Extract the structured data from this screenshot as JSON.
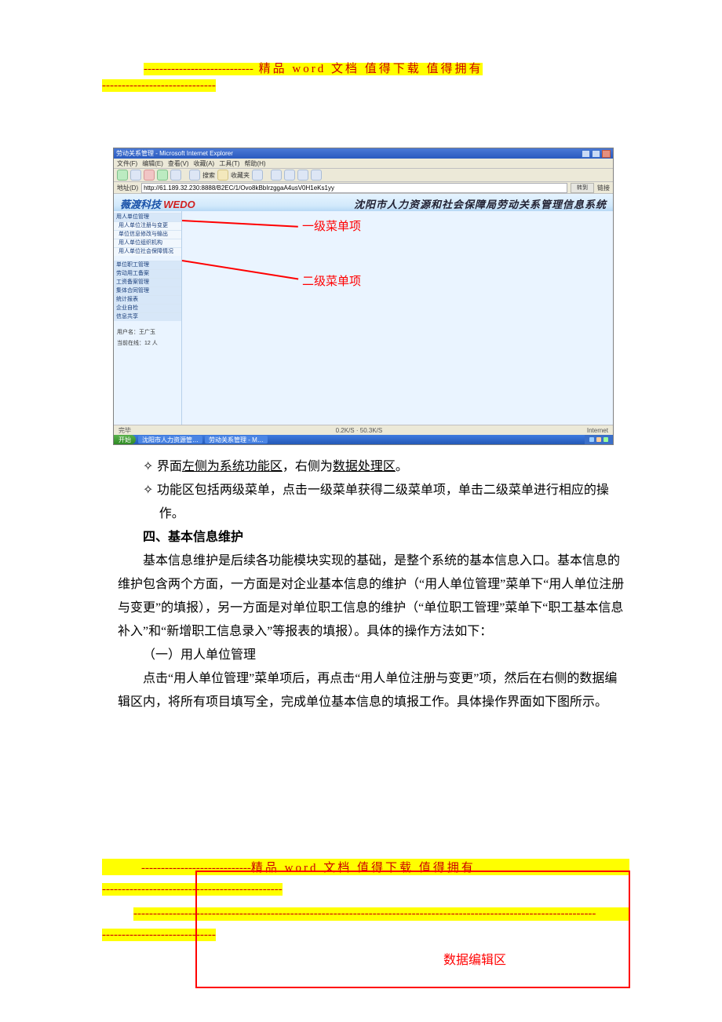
{
  "header": {
    "dashes1": "----------------------------",
    "line1_text": " 精品 word 文档  值得下载  值得拥有",
    "dashes2": "----------------------------------------------------------------------------------------------------------------------",
    "dashes2_second": "-----------------------------"
  },
  "screenshot": {
    "title": "劳动关系管理 - Microsoft Internet Explorer",
    "menus": [
      "文件(F)",
      "编辑(E)",
      "查看(V)",
      "收藏(A)",
      "工具(T)",
      "帮助(H)"
    ],
    "search_label": "搜索",
    "fav_label": "收藏夹",
    "addr_label": "地址(D)",
    "url": "http://61.189.32.230:8888/B2EC/1/Ovo8kBbIrzggaA4usV0H1eKs1yy",
    "go_label": "转到",
    "links_label": "链接",
    "logo_cn": "薇渡科技",
    "logo_en": "WEDO",
    "system_title": "沈阳市人力资源和社会保障局劳动关系管理信息系统",
    "side_menu": [
      {
        "label": "用人单位管理",
        "type": "top"
      },
      {
        "label": "用人单位注册与变更",
        "type": "sub"
      },
      {
        "label": "单位信息修改与输出",
        "type": "sub"
      },
      {
        "label": "用人单位组织机构",
        "type": "sub"
      },
      {
        "label": "用人单位社会保障情况",
        "type": "sub"
      },
      {
        "label": "单位职工管理",
        "type": "top"
      },
      {
        "label": "劳动用工备案",
        "type": "top"
      },
      {
        "label": "工资备案管理",
        "type": "top"
      },
      {
        "label": "集体合同管理",
        "type": "top"
      },
      {
        "label": "统计报表",
        "type": "top"
      },
      {
        "label": "企业自检",
        "type": "top"
      },
      {
        "label": "信息共享",
        "type": "top"
      }
    ],
    "user_label": "用户名：王广玉",
    "online_label": "当前在线：12 人",
    "status_left": "完毕",
    "status_mid": "0.2K/S · 50.3K/S",
    "status_right": "Internet",
    "start": "开始",
    "task_items": [
      "沈阳市人力资源管…",
      "劳动关系管理 - M…"
    ],
    "annotations": {
      "level1": "一级菜单项",
      "level2": "二级菜单项"
    }
  },
  "body": {
    "bullets": [
      "界面左侧为系统功能区，右侧为数据处理区。",
      "功能区包括两级菜单，点击一级菜单获得二级菜单项，单击二级菜单进行相应的操作。"
    ],
    "b1_p1": "界面",
    "b1_u1": "左侧为系统功能区",
    "b1_p2": "，右侧为",
    "b1_u2": "数据处理区",
    "b1_p3": "。",
    "heading4": "四、基本信息维护",
    "para1": "基本信息维护是后续各功能模块实现的基础，是整个系统的基本信息入口。基本信息的维护包含两个方面，一方面是对企业基本信息的维护（“用人单位管理”菜单下“用人单位注册与变更”的填报），另一方面是对单位职工信息的维护（“单位职工管理”菜单下“职工基本信息补入”和“新增职工信息录入”等报表的填报）。具体的操作方法如下：",
    "sub1": "（一）用人单位管理",
    "para2": "点击“用人单位管理”菜单项后，再点击“用人单位注册与变更”项，然后在右侧的数据编辑区内，将所有项目填写全，完成单位基本信息的填报工作。具体操作界面如下图所示。"
  },
  "footer": {
    "dashes_a": "----------------------------",
    "line_text": "精品 word 文档  值得下载  值得拥有",
    "dashes_b": "----------------------------------------------",
    "dashes_c": "----------------------------------------------------------------------------------------------------------------------",
    "dashes_d": "-----------------------------",
    "red_label": "数据编辑区"
  }
}
